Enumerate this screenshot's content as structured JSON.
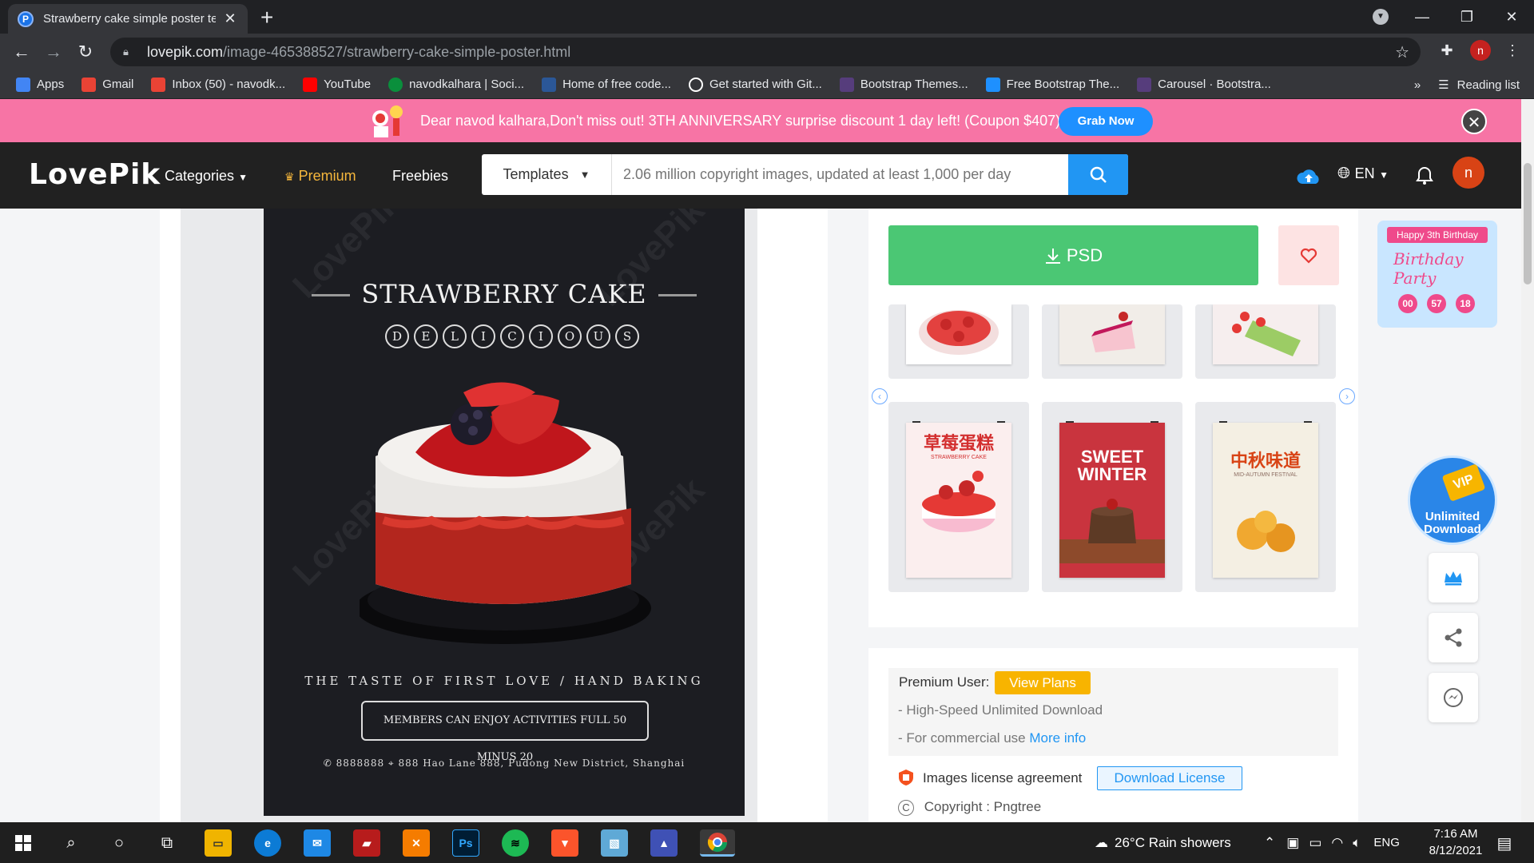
{
  "browser": {
    "tab_title": "Strawberry cake simple poster te",
    "tab_favicon": "P",
    "url_domain": "lovepik.com",
    "url_path": "/image-465388527/strawberry-cake-simple-poster.html",
    "profile_initial": "n"
  },
  "bookmarks": [
    {
      "label": "Apps",
      "icon": "apps-grid-icon",
      "color": "#4285f4"
    },
    {
      "label": "Gmail",
      "icon": "gmail-icon",
      "color": "#ea4335"
    },
    {
      "label": "Inbox (50) - navodk...",
      "icon": "gmail-icon",
      "color": "#ea4335"
    },
    {
      "label": "YouTube",
      "icon": "youtube-icon",
      "color": "#ff0000"
    },
    {
      "label": "navodkalhara | Soci...",
      "icon": "freecodecamp-icon",
      "color": "#0a8f3c"
    },
    {
      "label": "Home of free code...",
      "icon": "codepen-icon",
      "color": "#2b5797"
    },
    {
      "label": "Get started with Git...",
      "icon": "github-icon",
      "color": "#ffffff"
    },
    {
      "label": "Bootstrap Themes...",
      "icon": "bootstrap-icon",
      "color": "#563d7c"
    },
    {
      "label": "Free Bootstrap The...",
      "icon": "bootstrap-free-icon",
      "color": "#1e90ff"
    },
    {
      "label": "Carousel · Bootstra...",
      "icon": "bootstrap-icon",
      "color": "#563d7c"
    }
  ],
  "bookmarks_more": "»",
  "reading_list": "Reading list",
  "promo": {
    "message": "Dear navod kalhara,Don't miss out! 3TH ANNIVERSARY surprise discount 1 day left! (Coupon $407)",
    "cta": "Grab Now"
  },
  "site": {
    "logo": "LovePik",
    "nav_categories": "Categories",
    "nav_premium": "Premium",
    "nav_freebies": "Freebies",
    "search_category": "Templates",
    "search_placeholder": "2.06 million copyright images, updated at least 1,000 per day",
    "language": "EN",
    "avatar_initial": "n"
  },
  "poster": {
    "title": "STRAWBERRY CAKE",
    "letters": [
      "D",
      "E",
      "L",
      "I",
      "C",
      "I",
      "O",
      "U",
      "S"
    ],
    "tagline": "THE TASTE OF FIRST LOVE / HAND BAKING",
    "box_text": "MEMBERS CAN ENJOY ACTIVITIES FULL 50 MINUS 20",
    "phone": "8888888",
    "address": "888 Hao Lane 888, Pudong New District, Shanghai",
    "watermark": "LovePik"
  },
  "download": {
    "format_label": "PSD"
  },
  "related": [
    {
      "title": "",
      "bg": "#f5e7e7"
    },
    {
      "title": "",
      "bg": "#f1ede8"
    },
    {
      "title": "",
      "bg": "#f6eeee"
    },
    {
      "title": "草莓蛋糕",
      "subtitle": "STRAWBERRY CAKE",
      "bg": "#fbeeee"
    },
    {
      "title": "SWEET WINTER",
      "subtitle": "",
      "bg": "#c9343e"
    },
    {
      "title": "中秋味道",
      "subtitle": "MID-AUTUMN FESTIVAL",
      "bg": "#f4efe3"
    }
  ],
  "info": {
    "premium_user_label": "Premium User:",
    "view_plans": "View Plans",
    "feature_1": "- High-Speed Unlimited Download",
    "feature_2_prefix": "- For commercial use",
    "more_info": "More info",
    "license_label": "Images license agreement",
    "download_license": "Download License",
    "copyright": "Copyright : Pngtree"
  },
  "side": {
    "bday_title": "Happy 3th Birthday",
    "bday_party": "Birthday Party",
    "countdown": [
      "00",
      "57",
      "18"
    ],
    "vip_badge": "VIP",
    "vip_text_1": "Unlimited",
    "vip_text_2": "Download"
  },
  "taskbar": {
    "weather": "26°C  Rain showers",
    "lang": "ENG",
    "time": "7:16 AM",
    "date": "8/12/2021"
  },
  "colors": {
    "promo_bg": "#f774a5",
    "header_bg": "#212121",
    "download_green": "#4bc774",
    "search_blue": "#2196f3",
    "premium_gold": "#f6b73c"
  }
}
